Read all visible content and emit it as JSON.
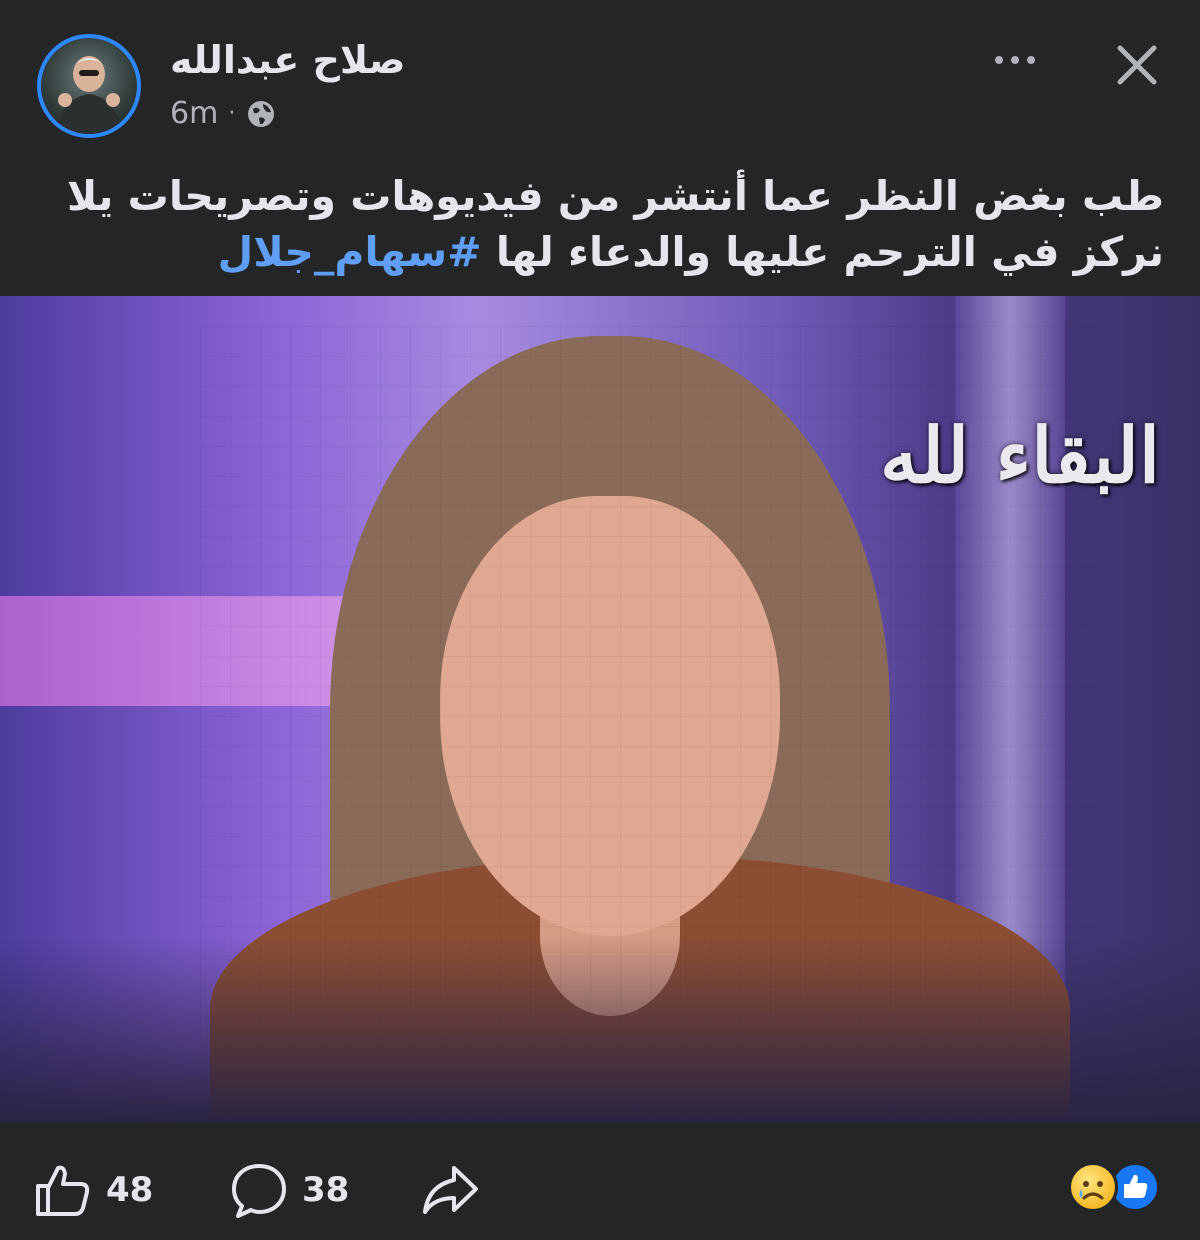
{
  "header": {
    "author_name": "صلاح عبدالله",
    "time": "6m",
    "separator": "·",
    "privacy_icon": "globe-icon",
    "more_icon": "more-icon",
    "close_icon": "close-icon"
  },
  "post": {
    "text": "طب بغض النظر عما أنتشر من فيديوهات وتصريحات يلا نركز في الترحم عليها والدعاء لها",
    "hashtag": "#سهام_جلال"
  },
  "photo": {
    "caption": "البقاء لله"
  },
  "footer": {
    "like_count": "48",
    "comment_count": "38",
    "like_icon": "thumbs-up-icon",
    "comment_icon": "comment-icon",
    "share_icon": "share-icon",
    "reactions": [
      "sad-reaction-icon",
      "like-reaction-icon"
    ]
  },
  "colors": {
    "background": "#242526",
    "text": "#e4e6eb",
    "secondary_text": "#b0b3b8",
    "hashtag": "#5e9ef5",
    "avatar_ring": "#2d88ff"
  }
}
